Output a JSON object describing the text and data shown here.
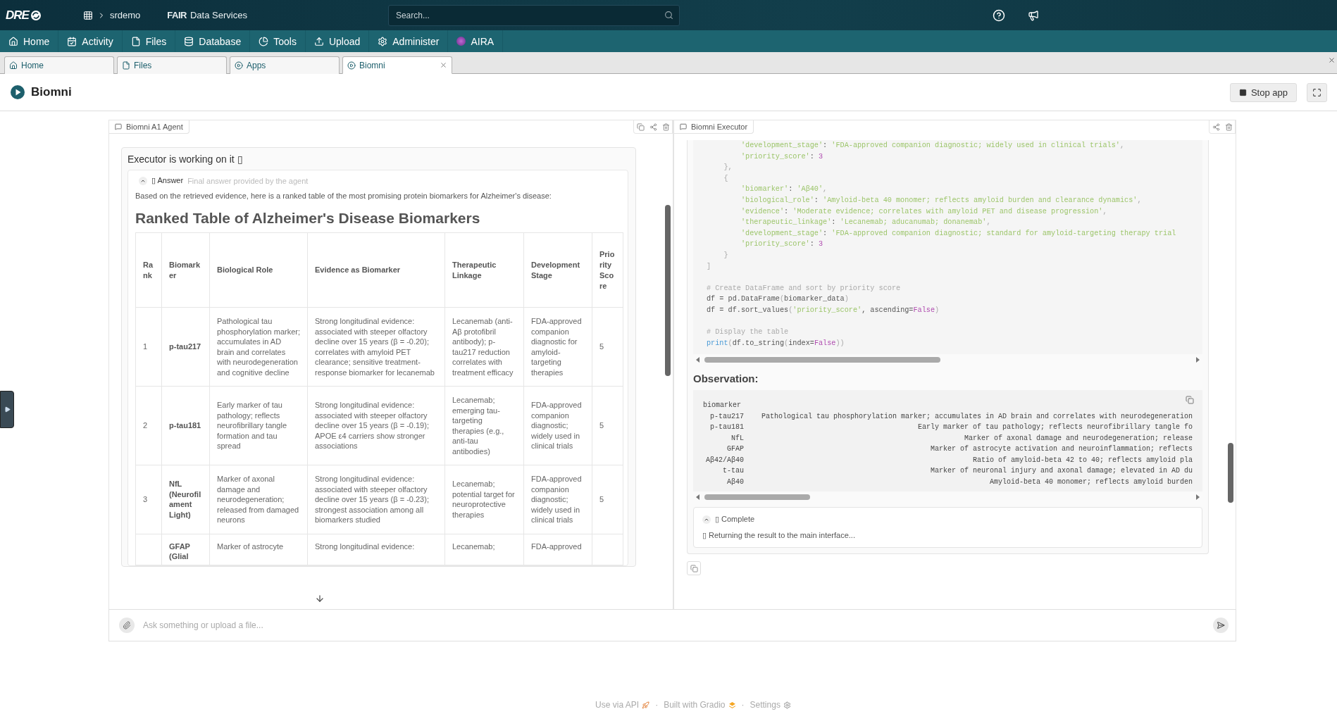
{
  "header": {
    "logo": "DRE",
    "breadcrumb": "srdemo",
    "brand_bold": "FAIR",
    "brand": "Data Services",
    "search": {
      "placeholder": "Search..."
    }
  },
  "nav": [
    "Home",
    "Activity",
    "Files",
    "Database",
    "Tools",
    "Upload",
    "Administer",
    "AIRA"
  ],
  "tabs": [
    {
      "label": "Home",
      "selected": false
    },
    {
      "label": "Files",
      "selected": false
    },
    {
      "label": "Apps",
      "selected": false
    },
    {
      "label": "Biomni",
      "selected": true
    }
  ],
  "app": {
    "title": "Biomni",
    "stop_button": "Stop app"
  },
  "agent_panel": {
    "label": "Biomni A1 Agent",
    "status": "Executor is working on it ▯",
    "answer": {
      "title": "▯ Answer",
      "subtitle": "Final answer provided by the agent",
      "expanded": true,
      "intro": "Based on the retrieved evidence, here is a ranked table of the most promising protein biomarkers for Alzheimer's disease:",
      "heading": "Ranked Table of Alzheimer's Disease Biomarkers",
      "columns": [
        "Rank",
        "Biomarker",
        "Biological Role",
        "Evidence as Biomarker",
        "Therapeutic Linkage",
        "Development Stage",
        "Priority Score"
      ],
      "rows": [
        [
          "1",
          "p-tau217",
          "Pathological tau phosphorylation marker; accumulates in AD brain and correlates with neurodegeneration and cognitive decline",
          "Strong longitudinal evidence: associated with steeper olfactory decline over 15 years (β = -0.20); correlates with amyloid PET clearance; sensitive treatment-response biomarker for lecanemab",
          "Lecanemab (anti-Aβ protofibril antibody); p-tau217 reduction correlates with treatment efficacy",
          "FDA-approved companion diagnostic for amyloid-targeting therapies",
          "5"
        ],
        [
          "2",
          "p-tau181",
          "Early marker of tau pathology; reflects neurofibrillary tangle formation and tau spread",
          "Strong longitudinal evidence: associated with steeper olfactory decline over 15 years (β = -0.19); APOE ε4 carriers show stronger associations",
          "Lecanemab; emerging tau-targeting therapies (e.g., anti-tau antibodies)",
          "FDA-approved companion diagnostic; widely used in clinical trials",
          "5"
        ],
        [
          "3",
          "NfL (Neurofilament Light)",
          "Marker of axonal damage and neurodegeneration; released from damaged neurons",
          "Strong longitudinal evidence: associated with steeper olfactory decline over 15 years (β = -0.23); strongest association among all biomarkers studied",
          "Lecanemab; potential target for neuroprotective therapies",
          "FDA-approved companion diagnostic; widely used in clinical trials",
          "5"
        ],
        [
          "",
          "GFAP (Glial",
          "Marker of astrocyte",
          "Strong longitudinal evidence:",
          "Lecanemab;",
          "FDA-approved",
          ""
        ]
      ]
    }
  },
  "executor_panel": {
    "label": "Biomni Executor",
    "code_lines": [
      {
        "gap_before": false,
        "tokens": [
          {
            "text": "        'development_stage'",
            "kind": "string"
          },
          {
            "text": ": ",
            "kind": "plain"
          },
          {
            "text": "'FDA-approved companion diagnostic; widely used in clinical trials'",
            "kind": "string"
          },
          {
            "text": ",",
            "kind": "punct"
          }
        ]
      },
      {
        "gap_before": false,
        "tokens": [
          {
            "text": "        'priority_score'",
            "kind": "string"
          },
          {
            "text": ": ",
            "kind": "plain"
          },
          {
            "text": "3",
            "kind": "number"
          }
        ]
      },
      {
        "gap_before": false,
        "tokens": [
          {
            "text": "    },",
            "kind": "punct"
          }
        ]
      },
      {
        "gap_before": false,
        "tokens": [
          {
            "text": "    {",
            "kind": "punct"
          }
        ]
      },
      {
        "gap_before": false,
        "tokens": [
          {
            "text": "        'biomarker'",
            "kind": "string"
          },
          {
            "text": ": ",
            "kind": "plain"
          },
          {
            "text": "'Aβ40'",
            "kind": "string"
          },
          {
            "text": ",",
            "kind": "punct"
          }
        ]
      },
      {
        "gap_before": false,
        "tokens": [
          {
            "text": "        'biological_role'",
            "kind": "string"
          },
          {
            "text": ": ",
            "kind": "plain"
          },
          {
            "text": "'Amyloid-beta 40 monomer; reflects amyloid burden and clearance dynamics'",
            "kind": "string"
          },
          {
            "text": ",",
            "kind": "punct"
          }
        ]
      },
      {
        "gap_before": false,
        "tokens": [
          {
            "text": "        'evidence'",
            "kind": "string"
          },
          {
            "text": ": ",
            "kind": "plain"
          },
          {
            "text": "'Moderate evidence; correlates with amyloid PET and disease progression'",
            "kind": "string"
          },
          {
            "text": ",",
            "kind": "punct"
          }
        ]
      },
      {
        "gap_before": false,
        "tokens": [
          {
            "text": "        'therapeutic_linkage'",
            "kind": "string"
          },
          {
            "text": ": ",
            "kind": "plain"
          },
          {
            "text": "'Lecanemab; aducanumab; donanemab'",
            "kind": "string"
          },
          {
            "text": ",",
            "kind": "punct"
          }
        ]
      },
      {
        "gap_before": false,
        "tokens": [
          {
            "text": "        'development_stage'",
            "kind": "string"
          },
          {
            "text": ": ",
            "kind": "plain"
          },
          {
            "text": "'FDA-approved companion diagnostic; standard for amyloid-targeting therapy trial",
            "kind": "string"
          }
        ]
      },
      {
        "gap_before": false,
        "tokens": [
          {
            "text": "        'priority_score'",
            "kind": "string"
          },
          {
            "text": ": ",
            "kind": "plain"
          },
          {
            "text": "3",
            "kind": "number"
          }
        ]
      },
      {
        "gap_before": false,
        "tokens": [
          {
            "text": "    }",
            "kind": "punct"
          }
        ]
      },
      {
        "gap_before": false,
        "tokens": [
          {
            "text": "]",
            "kind": "punct"
          }
        ]
      },
      {
        "gap_before": true,
        "tokens": [
          {
            "text": "# Create DataFrame and sort by priority score",
            "kind": "comment"
          }
        ]
      },
      {
        "gap_before": false,
        "tokens": [
          {
            "text": "df = pd.DataFrame",
            "kind": "plain"
          },
          {
            "text": "(",
            "kind": "punct"
          },
          {
            "text": "biomarker_data",
            "kind": "plain"
          },
          {
            "text": ")",
            "kind": "punct"
          }
        ]
      },
      {
        "gap_before": false,
        "tokens": [
          {
            "text": "df = df.sort_values",
            "kind": "plain"
          },
          {
            "text": "(",
            "kind": "punct"
          },
          {
            "text": "'priority_score'",
            "kind": "string"
          },
          {
            "text": ", ascending=",
            "kind": "plain"
          },
          {
            "text": "False",
            "kind": "keyword"
          },
          {
            "text": ")",
            "kind": "punct"
          }
        ]
      },
      {
        "gap_before": true,
        "tokens": [
          {
            "text": "# Display the table",
            "kind": "comment"
          }
        ]
      },
      {
        "gap_before": false,
        "tokens": [
          {
            "text": "print",
            "kind": "builtin"
          },
          {
            "text": "(",
            "kind": "punct"
          },
          {
            "text": "df.to_string",
            "kind": "plain"
          },
          {
            "text": "(",
            "kind": "punct"
          },
          {
            "text": "index=",
            "kind": "plain"
          },
          {
            "text": "False",
            "kind": "keyword"
          },
          {
            "text": "))",
            "kind": "punct"
          }
        ]
      }
    ],
    "observation": {
      "title": "Observation:",
      "header": "biomarker",
      "rows": [
        {
          "biomarker": "p-tau217",
          "text": "Pathological tau phosphorylation marker; accumulates in AD brain and correlates with neurodegeneration"
        },
        {
          "biomarker": "p-tau181",
          "text": "Early marker of tau pathology; reflects neurofibrillary tangle fo"
        },
        {
          "biomarker": "NfL",
          "text": "Marker of axonal damage and neurodegeneration; release"
        },
        {
          "biomarker": "GFAP",
          "text": "Marker of astrocyte activation and neuroinflammation; reflects"
        },
        {
          "biomarker": "Aβ42/Aβ40",
          "text": "Ratio of amyloid-beta 42 to 40; reflects amyloid pla"
        },
        {
          "biomarker": "t-tau",
          "text": "Marker of neuronal injury and axonal damage; elevated in AD du"
        },
        {
          "biomarker": "Aβ40",
          "text": "Amyloid-beta 40 monomer; reflects amyloid burden"
        }
      ]
    },
    "complete": {
      "title": "▯ Complete",
      "expanded": true,
      "message": "▯ Returning the result to the main interface..."
    }
  },
  "input": {
    "placeholder": "Ask something or upload a file..."
  },
  "footer": {
    "links": [
      "Use via API",
      "Built with Gradio",
      "Settings"
    ],
    "separators": [
      "·",
      "·"
    ]
  }
}
